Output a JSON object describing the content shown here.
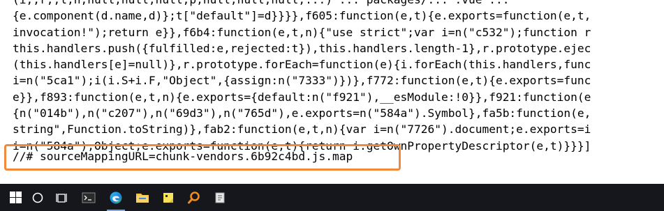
{
  "code_lines": [
    "(i,,r,,l,n,null,null,null,p,null,null,null,...) ... packages/... .vue\"... ",
    "{e.component(d.name,d)};t[\"default\"]=d}}}},f605:function(e,t){e.exports=function(e,t,",
    "invocation!\");return e}},f6b4:function(e,t,n){\"use strict\";var i=n(\"c532\");function r",
    "this.handlers.push({fulfilled:e,rejected:t}),this.handlers.length-1},r.prototype.ejec",
    "(this.handlers[e]=null)},r.prototype.forEach=function(e){i.forEach(this.handlers,func",
    "i=n(\"5ca1\");i(i.S+i.F,\"Object\",{assign:n(\"7333\")})},f772:function(e,t){e.exports=func",
    "e}},f893:function(e,t,n){e.exports={default:n(\"f921\"),__esModule:!0}},f921:function(e",
    "{n(\"014b\"),n(\"c207\"),n(\"69d3\"),n(\"765d\"),e.exports=n(\"584a\").Symbol},fa5b:function(e,",
    "string\",Function.toString)},fab2:function(e,t,n){var i=n(\"7726\").document;e.exports=i",
    "i=n(\"584a\"),Object;e.exports=function(e,t){return i.getOwnPropertyDescriptor(e,t)}}}]"
  ],
  "source_mapping_line": "//# sourceMappingURL=chunk-vendors.6b92c4bd.js.map",
  "highlight_color": "#f0893a",
  "taskbar": {
    "background": "#15171c",
    "items": [
      {
        "name": "start-button",
        "icon": "windows-logo-icon"
      },
      {
        "name": "search-button",
        "icon": "search-circle-icon"
      },
      {
        "name": "task-view-button",
        "icon": "task-view-icon"
      },
      {
        "name": "terminal-app",
        "icon": "terminal-icon"
      },
      {
        "name": "edge-browser-app",
        "icon": "edge-icon",
        "active": true
      },
      {
        "name": "file-explorer-app",
        "icon": "folder-icon"
      },
      {
        "name": "sticky-notes-app",
        "icon": "sticky-note-icon"
      },
      {
        "name": "search-tool-app",
        "icon": "magnifier-icon"
      },
      {
        "name": "notepad-app",
        "icon": "notepad-icon"
      }
    ]
  }
}
